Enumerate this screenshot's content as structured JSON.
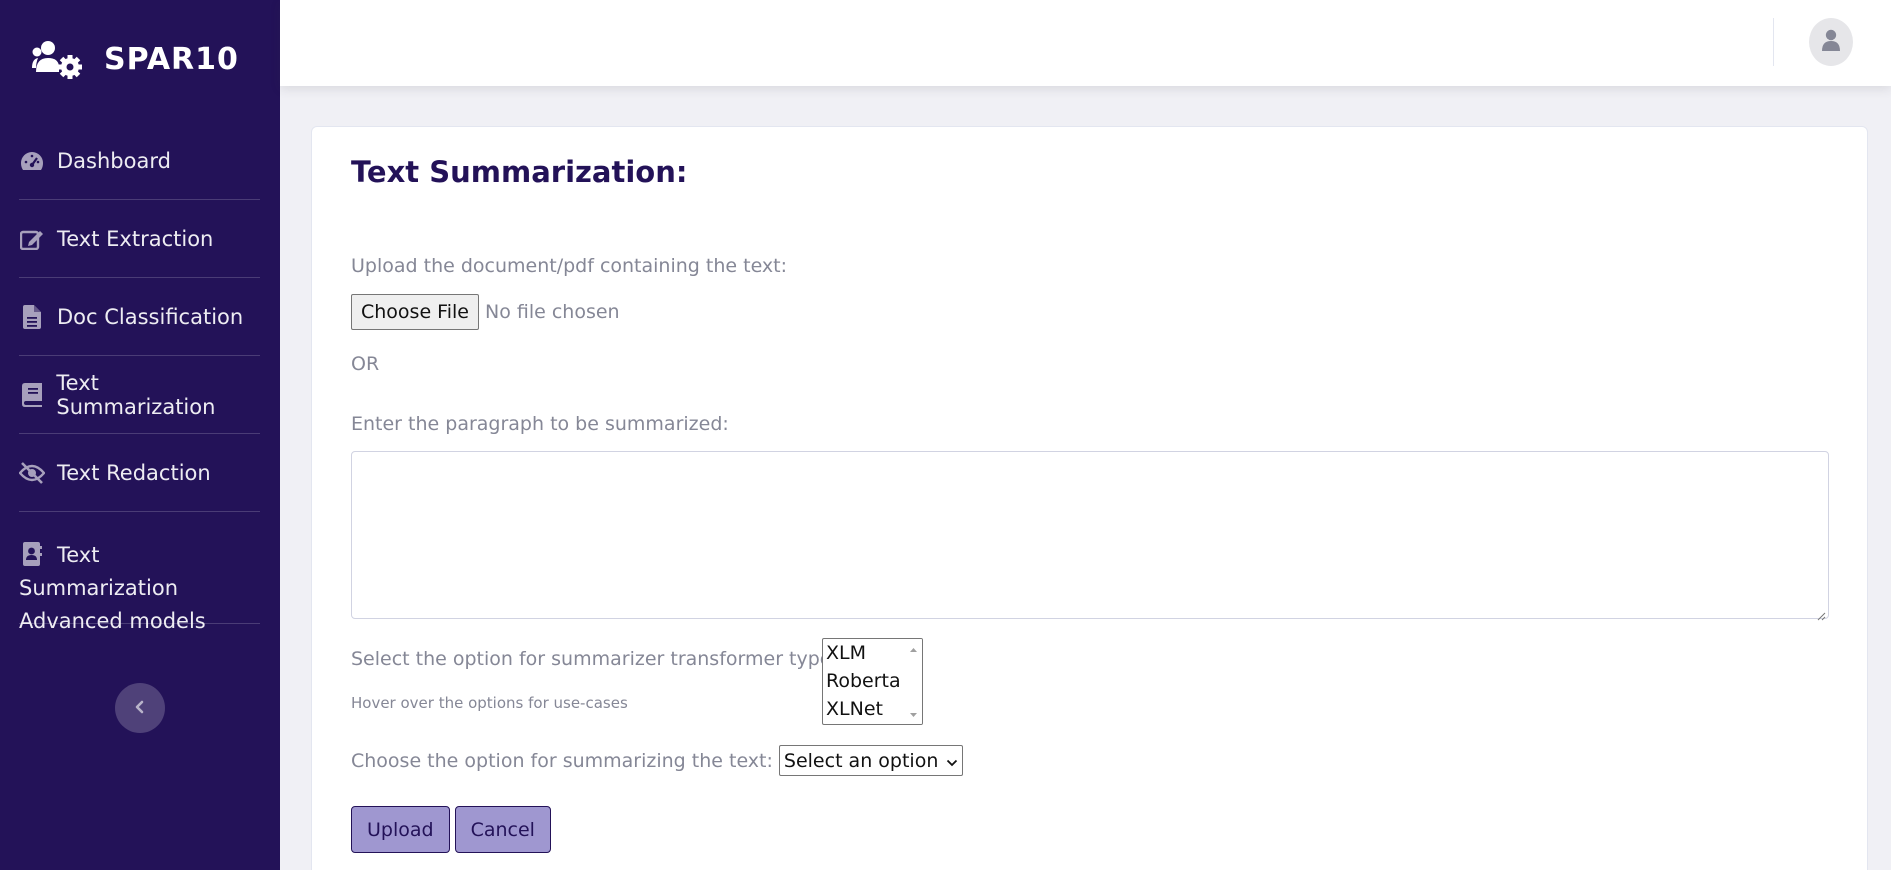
{
  "brand": {
    "name": "SPAR10",
    "icon": "users-cog-icon"
  },
  "sidebar": {
    "items": [
      {
        "label": "Dashboard",
        "icon": "tachometer-icon"
      },
      {
        "label": "Text Extraction",
        "icon": "edit-icon"
      },
      {
        "label": "Doc Classification",
        "icon": "file-alt-icon"
      },
      {
        "label": "Text Summarization",
        "icon": "book-icon"
      },
      {
        "label": "Text Redaction",
        "icon": "eye-slash-icon"
      },
      {
        "label": "Text Summarization Advanced models",
        "icon": "address-book-icon"
      }
    ],
    "toggle_icon": "chevron-left-icon"
  },
  "topbar": {
    "avatar_icon": "user-icon"
  },
  "main": {
    "title": "Text Summarization:",
    "upload_label": "Upload the document/pdf containing the text:",
    "choose_file_label": "Choose File",
    "file_status": "No file chosen",
    "or_label": "OR",
    "paragraph_label": "Enter the paragraph to be summarized:",
    "paragraph_value": "",
    "transformer_label": "Select the option for summarizer transformer type:",
    "transformer_hint": "Hover over the options for use-cases",
    "transformer_options": [
      "XLM",
      "Roberta",
      "XLNet"
    ],
    "summarize_label": "Choose the option for summarizing the text:",
    "summarize_selected": "Select an option",
    "upload_button": "Upload",
    "cancel_button": "Cancel"
  },
  "colors": {
    "sidebar_bg": "#231258",
    "title": "#231258",
    "button_bg": "#9f97d0",
    "page_bg": "#f0f0f5"
  }
}
